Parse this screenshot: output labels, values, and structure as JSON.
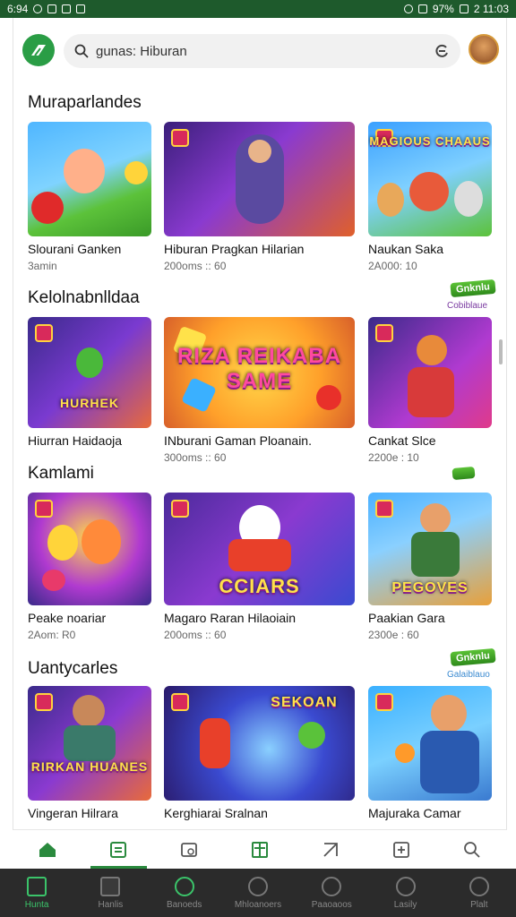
{
  "status": {
    "time_left": "6:94",
    "battery": "97%",
    "time_right": "2 11:03"
  },
  "search": {
    "text": "gunas: Hiburan"
  },
  "sections": [
    {
      "title": "Muraparlandes",
      "badge": "",
      "subbadge": "",
      "cards": [
        {
          "title": "Slourani Ganken",
          "meta": "3amin",
          "overlay": ""
        },
        {
          "title": "Hiburan Pragkan Hilarian",
          "meta": "200oms :: 60",
          "overlay": ""
        },
        {
          "title": "Naukan Saka",
          "meta": "2A000: 10",
          "overlay": "MAGIOUS CHAAUS"
        }
      ]
    },
    {
      "title": "Kelolnabnlldaa",
      "badge": "Gnknlu",
      "subbadge": "Cobiblaue",
      "cards": [
        {
          "title": "Hiurran Haidaoja",
          "meta": "",
          "overlay": "HURHEK"
        },
        {
          "title": "INburani Gaman Ploanain.",
          "meta": "300oms :: 60",
          "overlay": "RIZA REIKABA SAME"
        },
        {
          "title": "Cankat Slce",
          "meta": "2200e : 10",
          "overlay": ""
        }
      ]
    },
    {
      "title": "Kamlami",
      "badge": "",
      "subbadge": "",
      "cards": [
        {
          "title": "Peake noariar",
          "meta": "2Aom: R0",
          "overlay": ""
        },
        {
          "title": "Magaro Raran Hilaoiain",
          "meta": "200oms :: 60",
          "overlay": "CCIARS"
        },
        {
          "title": "Paakian Gara",
          "meta": "2300e : 60",
          "overlay": "PEGOVES"
        }
      ]
    },
    {
      "title": "Uantycarles",
      "badge": "Gnknlu",
      "subbadge": "Galaiblauo",
      "cards": [
        {
          "title": "Vingeran Hilrara",
          "meta": "",
          "overlay": "RIRKAN HUANES"
        },
        {
          "title": "Kerghiarai Sralnan",
          "meta": "",
          "overlay": "SEKOAN"
        },
        {
          "title": "Majuraka Camar",
          "meta": "",
          "overlay": ""
        }
      ]
    }
  ],
  "bottom_nav": [
    {
      "label": "Hunta",
      "icon": "home-icon",
      "active": true
    },
    {
      "label": "Hanlis",
      "icon": "grid-icon",
      "active": false
    },
    {
      "label": "Banoeds",
      "icon": "circle-icon",
      "active": false
    },
    {
      "label": "Mhloanoers",
      "icon": "run-icon",
      "active": false
    },
    {
      "label": "Paaoaoos",
      "icon": "settings-icon",
      "active": false
    },
    {
      "label": "Lasily",
      "icon": "shield-icon",
      "active": false
    },
    {
      "label": "Plalt",
      "icon": "person-icon",
      "active": false
    }
  ],
  "colors": {
    "status_bar": "#1e5a2c",
    "accent": "#2a8a3e",
    "bottom_nav_bg": "#2b2b2b"
  }
}
